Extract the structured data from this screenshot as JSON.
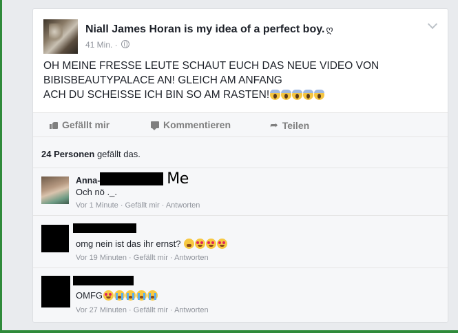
{
  "post": {
    "page_name": "Niall James Horan is my idea of a perfect boy.",
    "page_name_suffix": "ღ",
    "time": "41 Min. ·",
    "text_lines": [
      "OH MEINE FRESSE LEUTE SCHAUT EUCH DAS NEUE VIDEO VON",
      "BIBISBEAUTYPALACE AN! GLEICH AM ANFANG",
      "ACH DU SCHEISSE ICH BIN SO AM RASTEN!"
    ],
    "trailing_emoji": [
      "scream",
      "scream",
      "scream",
      "scream",
      "scream"
    ]
  },
  "actions": {
    "like": "Gefällt mir",
    "comment": "Kommentieren",
    "share": "Teilen"
  },
  "likes": {
    "count": "24 Personen",
    "suffix": " gefällt das."
  },
  "comments": [
    {
      "name": "Anna-",
      "text": "Och nö ._.",
      "time": "Vor 1 Minute",
      "like": "Gefällt mir",
      "reply": "Antworten",
      "emoji": []
    },
    {
      "name": "",
      "text": "omg nein ist das ihr ernst?",
      "time": "Vor 19 Minuten",
      "like": "Gefällt mir",
      "reply": "Antworten",
      "emoji": [
        "tired",
        "hearteyes",
        "hearteyes",
        "hearteyes"
      ]
    },
    {
      "name": "",
      "text": "OMFG",
      "time": "Vor 27 Minuten",
      "like": "Gefällt mir",
      "reply": "Antworten",
      "emoji": [
        "hearteyes",
        "sob",
        "sob",
        "sob",
        "sob"
      ]
    }
  ],
  "annotation": "<-- Me",
  "colors": {
    "background": "#e9ebee",
    "text": "#1d2129",
    "meta": "#90949c",
    "frame": "#2f8a3a"
  }
}
